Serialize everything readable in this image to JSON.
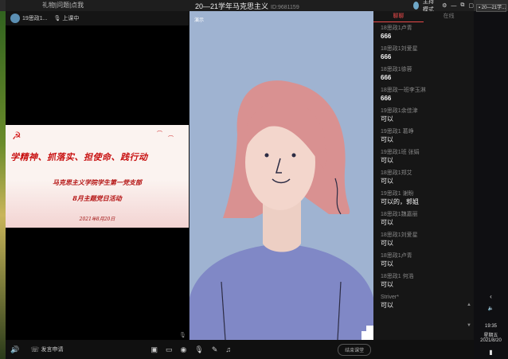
{
  "window": {
    "title": "20—21学年马克思主义",
    "id_label": "ID:9681159",
    "left_hint": "礼物|问题|点我",
    "host_mode": "主持模式"
  },
  "presenter": {
    "name": "19思政1...",
    "status": "上课中"
  },
  "slide": {
    "title": "学精神、抓落实、担使命、践行动",
    "org": "马克思主义学院学生第一党支部",
    "event": "8月主题党日活动",
    "date": "2021年8月20日"
  },
  "main_video": {
    "label": "演示"
  },
  "chat": {
    "tabs": [
      {
        "label": "聊聊",
        "active": true
      },
      {
        "label": "在线",
        "active": false
      }
    ],
    "messages": [
      {
        "user": "18思政1卢青",
        "text": "666"
      },
      {
        "user": "18思政1刘爱星",
        "text": "666"
      },
      {
        "user": "18思政1徐蓉",
        "text": "666"
      },
      {
        "user": "18思政一班李玉淋",
        "text": "666"
      },
      {
        "user": "19思政1余佳津",
        "text": "可以"
      },
      {
        "user": "19思政1 葛峥",
        "text": "可以"
      },
      {
        "user": "19思政1班 张娟",
        "text": "可以"
      },
      {
        "user": "18思政1郑艾",
        "text": "可以"
      },
      {
        "user": "19思政1 谢盼",
        "text": "可以的，郭姐"
      },
      {
        "user": "18思政1魏嘉丽",
        "text": "可以"
      },
      {
        "user": "18思政1刘爱星",
        "text": "可以"
      },
      {
        "user": "18思政1卢青",
        "text": "可以"
      },
      {
        "user": "18思政1 何浩",
        "text": "可以"
      },
      {
        "user": "Striver*",
        "text": "可以"
      }
    ]
  },
  "toolbar": {
    "apply_speak": "发言申请",
    "end_class": "结束课堂"
  },
  "desktop": {
    "task_label": "20—21学...",
    "time": "19:35",
    "weekday": "星期五",
    "date": "2021/8/20"
  },
  "colors": {
    "accent": "#e84a4a",
    "slide_red": "#c81010",
    "main_bg": "#9fb3d1"
  }
}
